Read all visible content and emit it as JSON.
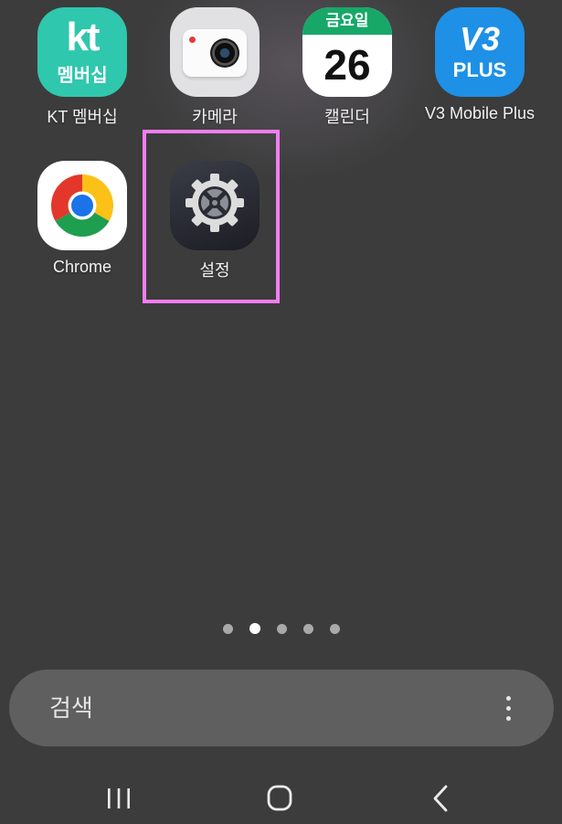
{
  "apps": [
    {
      "label": "KT 멤버십",
      "icon_text": "kt",
      "icon_subtext": "멤버십",
      "icon": "kt-membership-icon"
    },
    {
      "label": "카메라",
      "icon": "camera-icon"
    },
    {
      "label": "캘린더",
      "icon_header": "금요일",
      "icon_day": "26",
      "icon": "calendar-icon"
    },
    {
      "label": "V3 Mobile Plus",
      "icon_text": "V3",
      "icon_subtext": "PLUS",
      "icon": "v3-icon"
    },
    {
      "label": "Chrome",
      "icon": "chrome-icon"
    },
    {
      "label": "설정",
      "icon": "settings-gear-icon"
    }
  ],
  "page_indicator": {
    "count": 5,
    "active_index": 1
  },
  "search": {
    "placeholder": "검색"
  },
  "navigation": [
    "recent-apps-icon",
    "home-icon",
    "back-icon"
  ],
  "colors": {
    "background": "#3c3c3c",
    "highlight": "#f27ef0",
    "search_bar": "#5f5f5f"
  }
}
